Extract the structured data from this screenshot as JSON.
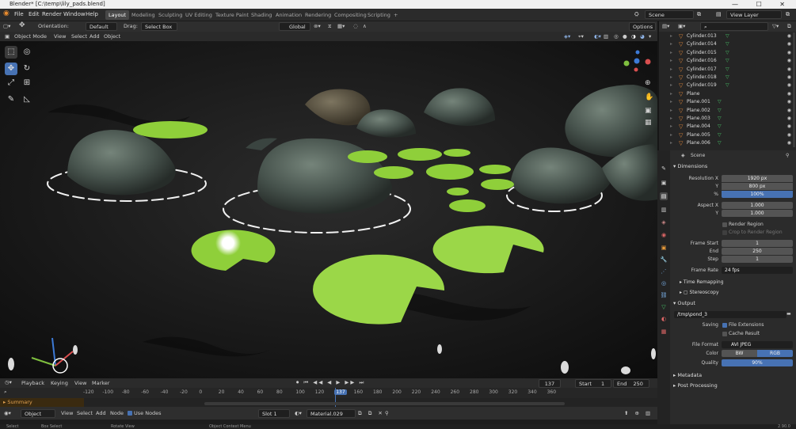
{
  "window": {
    "title": "Blender* [C:\\temp\\lily_pads.blend]",
    "controls": "— ☐ ✕"
  },
  "menu": [
    "File",
    "Edit",
    "Render",
    "Window",
    "Help"
  ],
  "workspaces": [
    {
      "label": "Layout",
      "active": true
    },
    {
      "label": "Modeling"
    },
    {
      "label": "Sculpting"
    },
    {
      "label": "UV Editing"
    },
    {
      "label": "Texture Paint"
    },
    {
      "label": "Shading"
    },
    {
      "label": "Animation"
    },
    {
      "label": "Rendering"
    },
    {
      "label": "Compositing"
    },
    {
      "label": "Scripting"
    },
    {
      "label": "+"
    }
  ],
  "scene": {
    "label": "Scene",
    "view_layer": "View Layer"
  },
  "viewport_header": {
    "orientation_label": "Orientation:",
    "orientation": "Default",
    "drag_label": "Drag:",
    "drag": "Select Box",
    "transform": "Global",
    "options": "Options"
  },
  "viewport_header2": {
    "mode": "Object Mode",
    "items": [
      "View",
      "Select",
      "Add",
      "Object"
    ]
  },
  "outliner": {
    "items": [
      "Cylinder.013",
      "Cylinder.014",
      "Cylinder.015",
      "Cylinder.016",
      "Cylinder.017",
      "Cylinder.018",
      "Cylinder.019",
      "Plane",
      "Plane.001",
      "Plane.002",
      "Plane.003",
      "Plane.004",
      "Plane.005",
      "Plane.006"
    ]
  },
  "props": {
    "scene_label": "Scene",
    "dimensions": {
      "header": "Dimensions",
      "res_x_label": "Resolution X",
      "res_x": "1920 px",
      "res_y_label": "Y",
      "res_y": "800 px",
      "pct_label": "%",
      "pct": "100%",
      "aspect_x_label": "Aspect X",
      "aspect_x": "1.000",
      "aspect_y_label": "Y",
      "aspect_y": "1.000",
      "render_region": "Render Region",
      "crop": "Crop to Render Region",
      "frame_start_label": "Frame Start",
      "frame_start": "1",
      "end_label": "End",
      "end": "250",
      "step_label": "Step",
      "step": "1",
      "frame_rate_label": "Frame Rate",
      "frame_rate": "24 fps",
      "time_remap": "Time Remapping",
      "stereo": "Stereoscopy"
    },
    "output": {
      "header": "Output",
      "path": "/tmp\\pond_3",
      "saving_label": "Saving",
      "file_ext": "File Extensions",
      "cache": "Cache Result",
      "format_label": "File Format",
      "format": "AVI JPEG",
      "color_label": "Color",
      "bw": "BW",
      "rgb": "RGB",
      "quality_label": "Quality",
      "quality": "90%"
    },
    "metadata": "Metadata",
    "post": "Post Processing"
  },
  "timeline": {
    "menu": [
      "Playback",
      "Keying",
      "View",
      "Marker"
    ],
    "current": "137",
    "start_label": "Start",
    "start": "1",
    "end_label": "End",
    "end": "250",
    "summary": "Summary",
    "ruler": [
      "-120",
      "-100",
      "-80",
      "-60",
      "-40",
      "-20",
      "0",
      "20",
      "40",
      "60",
      "80",
      "100",
      "120",
      "137",
      "160",
      "180",
      "200",
      "220",
      "240",
      "260",
      "280",
      "300",
      "320",
      "340",
      "360"
    ]
  },
  "node_editor": {
    "type": "Object",
    "items": [
      "View",
      "Select",
      "Add",
      "Node"
    ],
    "use_nodes": "Use Nodes",
    "slot": "Slot 1",
    "material": "Material.029"
  },
  "status": {
    "select": "Select",
    "box": "Box Select",
    "rotate": "Rotate View",
    "ctx": "Object Context Menu",
    "version": "2.90.0"
  }
}
